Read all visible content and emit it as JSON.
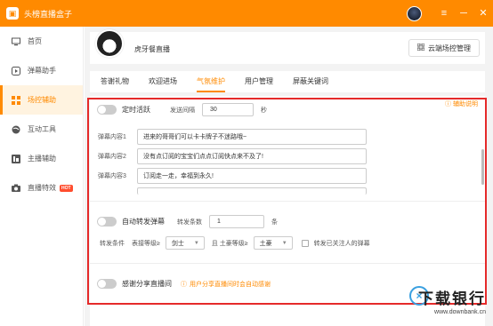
{
  "app": {
    "title": "头榜直播盒子"
  },
  "titlebar": {
    "menu_icon": "≡",
    "minimize_icon": "─",
    "close_icon": "✕"
  },
  "sidebar": {
    "items": [
      {
        "label": "首页",
        "icon": "monitor-icon"
      },
      {
        "label": "弹幕助手",
        "icon": "play-icon"
      },
      {
        "label": "场控辅助",
        "icon": "grid-icon",
        "active": true
      },
      {
        "label": "互动工具",
        "icon": "globe-icon"
      },
      {
        "label": "主播辅助",
        "icon": "dashboard-icon"
      },
      {
        "label": "直播特效",
        "icon": "camera-icon",
        "badge": "HOT"
      }
    ]
  },
  "profile": {
    "name": "虎牙餐直播",
    "cloud_button": "云端场控管理"
  },
  "tabs": [
    {
      "label": "答谢礼物"
    },
    {
      "label": "欢迎进场"
    },
    {
      "label": "气氛维护",
      "active": true
    },
    {
      "label": "用户管理"
    },
    {
      "label": "屏蔽关键词"
    }
  ],
  "panel": {
    "help": "辅助说明",
    "timed": {
      "label": "定时活跃",
      "interval_label": "发送间隔",
      "interval_value": "30",
      "unit": "秒"
    },
    "messages": [
      {
        "label": "弹幕内容1",
        "value": "进来的哥哥们可以卡卡牌子不迷路哦~"
      },
      {
        "label": "弹幕内容2",
        "value": "没有点订阅的宝宝们点点订阅快点来不及了!"
      },
      {
        "label": "弹幕内容3",
        "value": "订阅走一走，幸福到永久!"
      }
    ],
    "forward": {
      "label": "自动转发弹幕",
      "count_label": "转发条数",
      "count_value": "1",
      "count_unit": "条",
      "cond_label": "转发条件",
      "level1_label": "表接等级≥",
      "level1_value": "剑士",
      "and_label": "且 土豪等级≥",
      "level2_value": "土豪",
      "follow_label": "转发已关注人的弹幕"
    },
    "share": {
      "label": "感谢分享直播间",
      "hint": "用户分享直播间时会自动感谢"
    }
  },
  "watermark": {
    "title": "下载银行",
    "url": "www.downbank.cn"
  },
  "colors": {
    "accent": "#ff8a00",
    "frame": "#e52a2a",
    "hot": "#ff4d2e"
  }
}
